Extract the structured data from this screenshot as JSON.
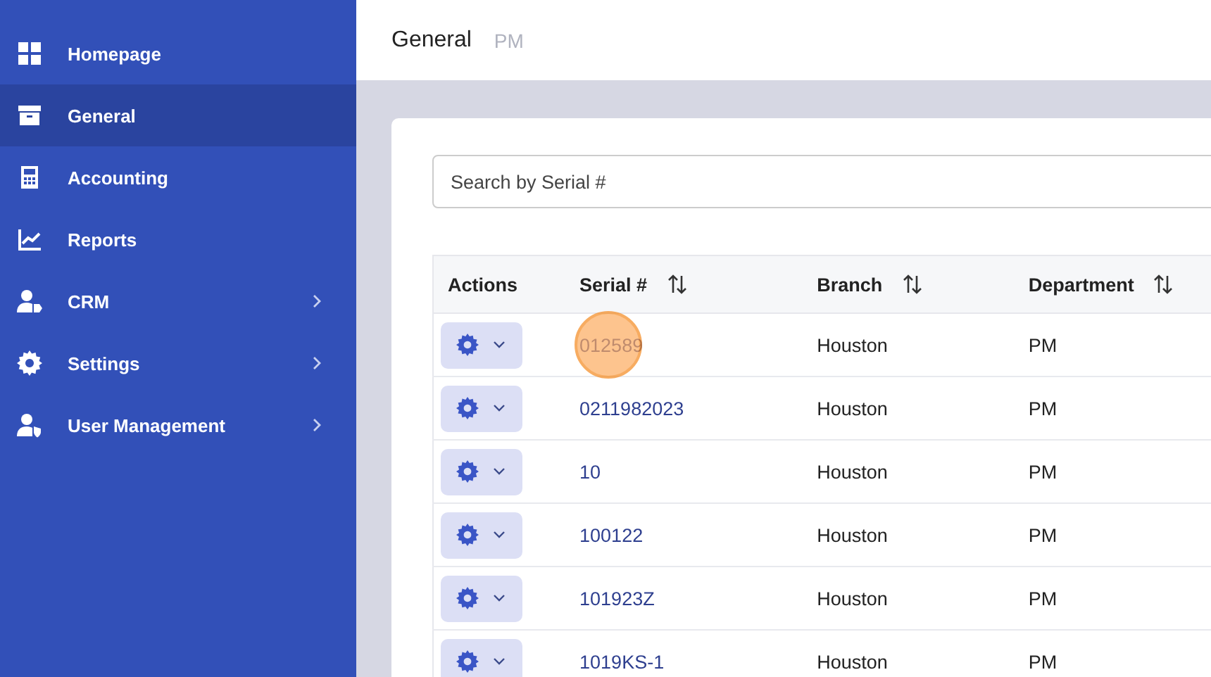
{
  "sidebar": {
    "items": [
      {
        "label": "Homepage",
        "selected": false,
        "has_submenu": false
      },
      {
        "label": "General",
        "selected": true,
        "has_submenu": false
      },
      {
        "label": "Accounting",
        "selected": false,
        "has_submenu": false
      },
      {
        "label": "Reports",
        "selected": false,
        "has_submenu": false
      },
      {
        "label": "CRM",
        "selected": false,
        "has_submenu": true
      },
      {
        "label": "Settings",
        "selected": false,
        "has_submenu": true
      },
      {
        "label": "User Management",
        "selected": false,
        "has_submenu": true
      }
    ]
  },
  "header": {
    "title": "General",
    "subtitle": "PM"
  },
  "search": {
    "placeholder": "Search by Serial #"
  },
  "table": {
    "columns": [
      {
        "label": "Actions",
        "sortable": false
      },
      {
        "label": "Serial #",
        "sortable": true
      },
      {
        "label": "Branch",
        "sortable": true
      },
      {
        "label": "Department",
        "sortable": true
      }
    ],
    "rows": [
      {
        "serial": "012589",
        "branch": "Houston",
        "department": "PM",
        "clicked": true
      },
      {
        "serial": "0211982023",
        "branch": "Houston",
        "department": "PM",
        "clicked": false
      },
      {
        "serial": "10",
        "branch": "Houston",
        "department": "PM",
        "clicked": false
      },
      {
        "serial": "100122",
        "branch": "Houston",
        "department": "PM",
        "clicked": false
      },
      {
        "serial": "101923Z",
        "branch": "Houston",
        "department": "PM",
        "clicked": false
      },
      {
        "serial": "1019KS-1",
        "branch": "Houston",
        "department": "PM",
        "clicked": false
      }
    ]
  }
}
